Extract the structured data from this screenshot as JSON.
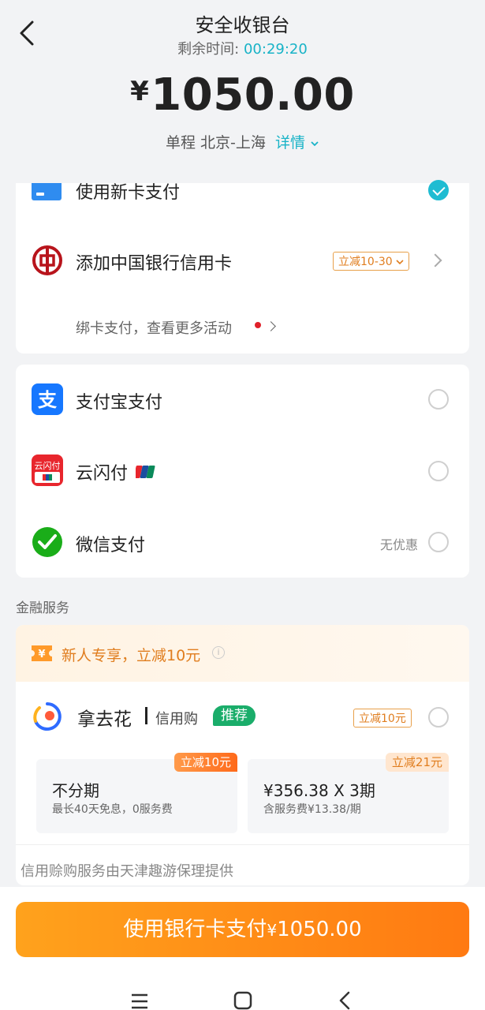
{
  "header": {
    "title": "安全收银台",
    "timer_label": "剩余时间:",
    "timer_value": "00:29:20",
    "amount_currency": "¥",
    "amount_value": "1050.00",
    "trip_type": "单程",
    "route": "北京-上海",
    "detail_label": "详情"
  },
  "card_methods": {
    "new_card_label": "使用新卡支付",
    "boc_label": "添加中国银行信用卡",
    "boc_promo": "立减10-30",
    "bind_label": "绑卡支付，查看更多活动"
  },
  "payment_options": [
    {
      "label": "支付宝支付",
      "note": ""
    },
    {
      "label": "云闪付",
      "note": ""
    },
    {
      "label": "微信支付",
      "note": "无优惠"
    }
  ],
  "finance": {
    "section_title": "金融服务",
    "banner_text": "新人专享，立减10元",
    "product_name": "拿去花",
    "product_sub": "信用购",
    "recommend_badge": "推荐",
    "product_promo": "立减10元",
    "plans": [
      {
        "title": "不分期",
        "subtitle": "最长40天免息，0服务费",
        "badge": "立减10元"
      },
      {
        "title": "¥356.38 X 3期",
        "subtitle": "含服务费¥13.38/期",
        "badge": "立减21元"
      }
    ],
    "provider_note": "信用赊购服务由天津趣游保理提供"
  },
  "footer": {
    "pay_label": "使用银行卡支付",
    "pay_currency": "¥",
    "pay_amount": "1050.00"
  },
  "colors": {
    "accent": "#18b3c7",
    "orange": "#ff8a1a",
    "promo": "#e07d1e"
  }
}
